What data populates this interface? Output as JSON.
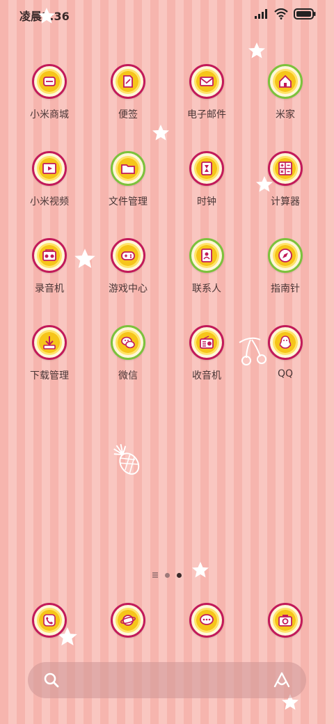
{
  "status_bar": {
    "time": "凌晨2:36",
    "icons": [
      "signal-icon",
      "wifi-icon",
      "battery-icon"
    ]
  },
  "apps": [
    {
      "label": "小米商城",
      "icon": "store-icon",
      "ring": "magenta"
    },
    {
      "label": "便签",
      "icon": "notes-icon",
      "ring": "magenta"
    },
    {
      "label": "电子邮件",
      "icon": "mail-icon",
      "ring": "magenta"
    },
    {
      "label": "米家",
      "icon": "home-icon",
      "ring": "green"
    },
    {
      "label": "小米视频",
      "icon": "video-icon",
      "ring": "magenta"
    },
    {
      "label": "文件管理",
      "icon": "folder-icon",
      "ring": "green"
    },
    {
      "label": "时钟",
      "icon": "hourglass-icon",
      "ring": "magenta"
    },
    {
      "label": "计算器",
      "icon": "calculator-icon",
      "ring": "magenta"
    },
    {
      "label": "录音机",
      "icon": "recorder-icon",
      "ring": "magenta"
    },
    {
      "label": "游戏中心",
      "icon": "gamepad-icon",
      "ring": "magenta"
    },
    {
      "label": "联系人",
      "icon": "contacts-icon",
      "ring": "green"
    },
    {
      "label": "指南针",
      "icon": "compass-icon",
      "ring": "green"
    },
    {
      "label": "下载管理",
      "icon": "download-icon",
      "ring": "magenta"
    },
    {
      "label": "微信",
      "icon": "wechat-icon",
      "ring": "green"
    },
    {
      "label": "收音机",
      "icon": "radio-icon",
      "ring": "magenta"
    },
    {
      "label": "QQ",
      "icon": "qq-icon",
      "ring": "magenta"
    }
  ],
  "page_indicator": {
    "pages": 3,
    "current": 3
  },
  "dock": [
    {
      "icon": "phone-icon"
    },
    {
      "icon": "browser-planet-icon"
    },
    {
      "icon": "messages-icon"
    },
    {
      "icon": "camera-icon"
    }
  ],
  "search_bar": {
    "left_icon": "search-icon",
    "right_icon": "assistant-icon"
  },
  "colors": {
    "stripe_dark": "#f6b5ae",
    "stripe_light": "#f9c6c0",
    "ring_magenta": "#c21a5a",
    "ring_green": "#7cc23c",
    "flower": "#f6c51a"
  }
}
